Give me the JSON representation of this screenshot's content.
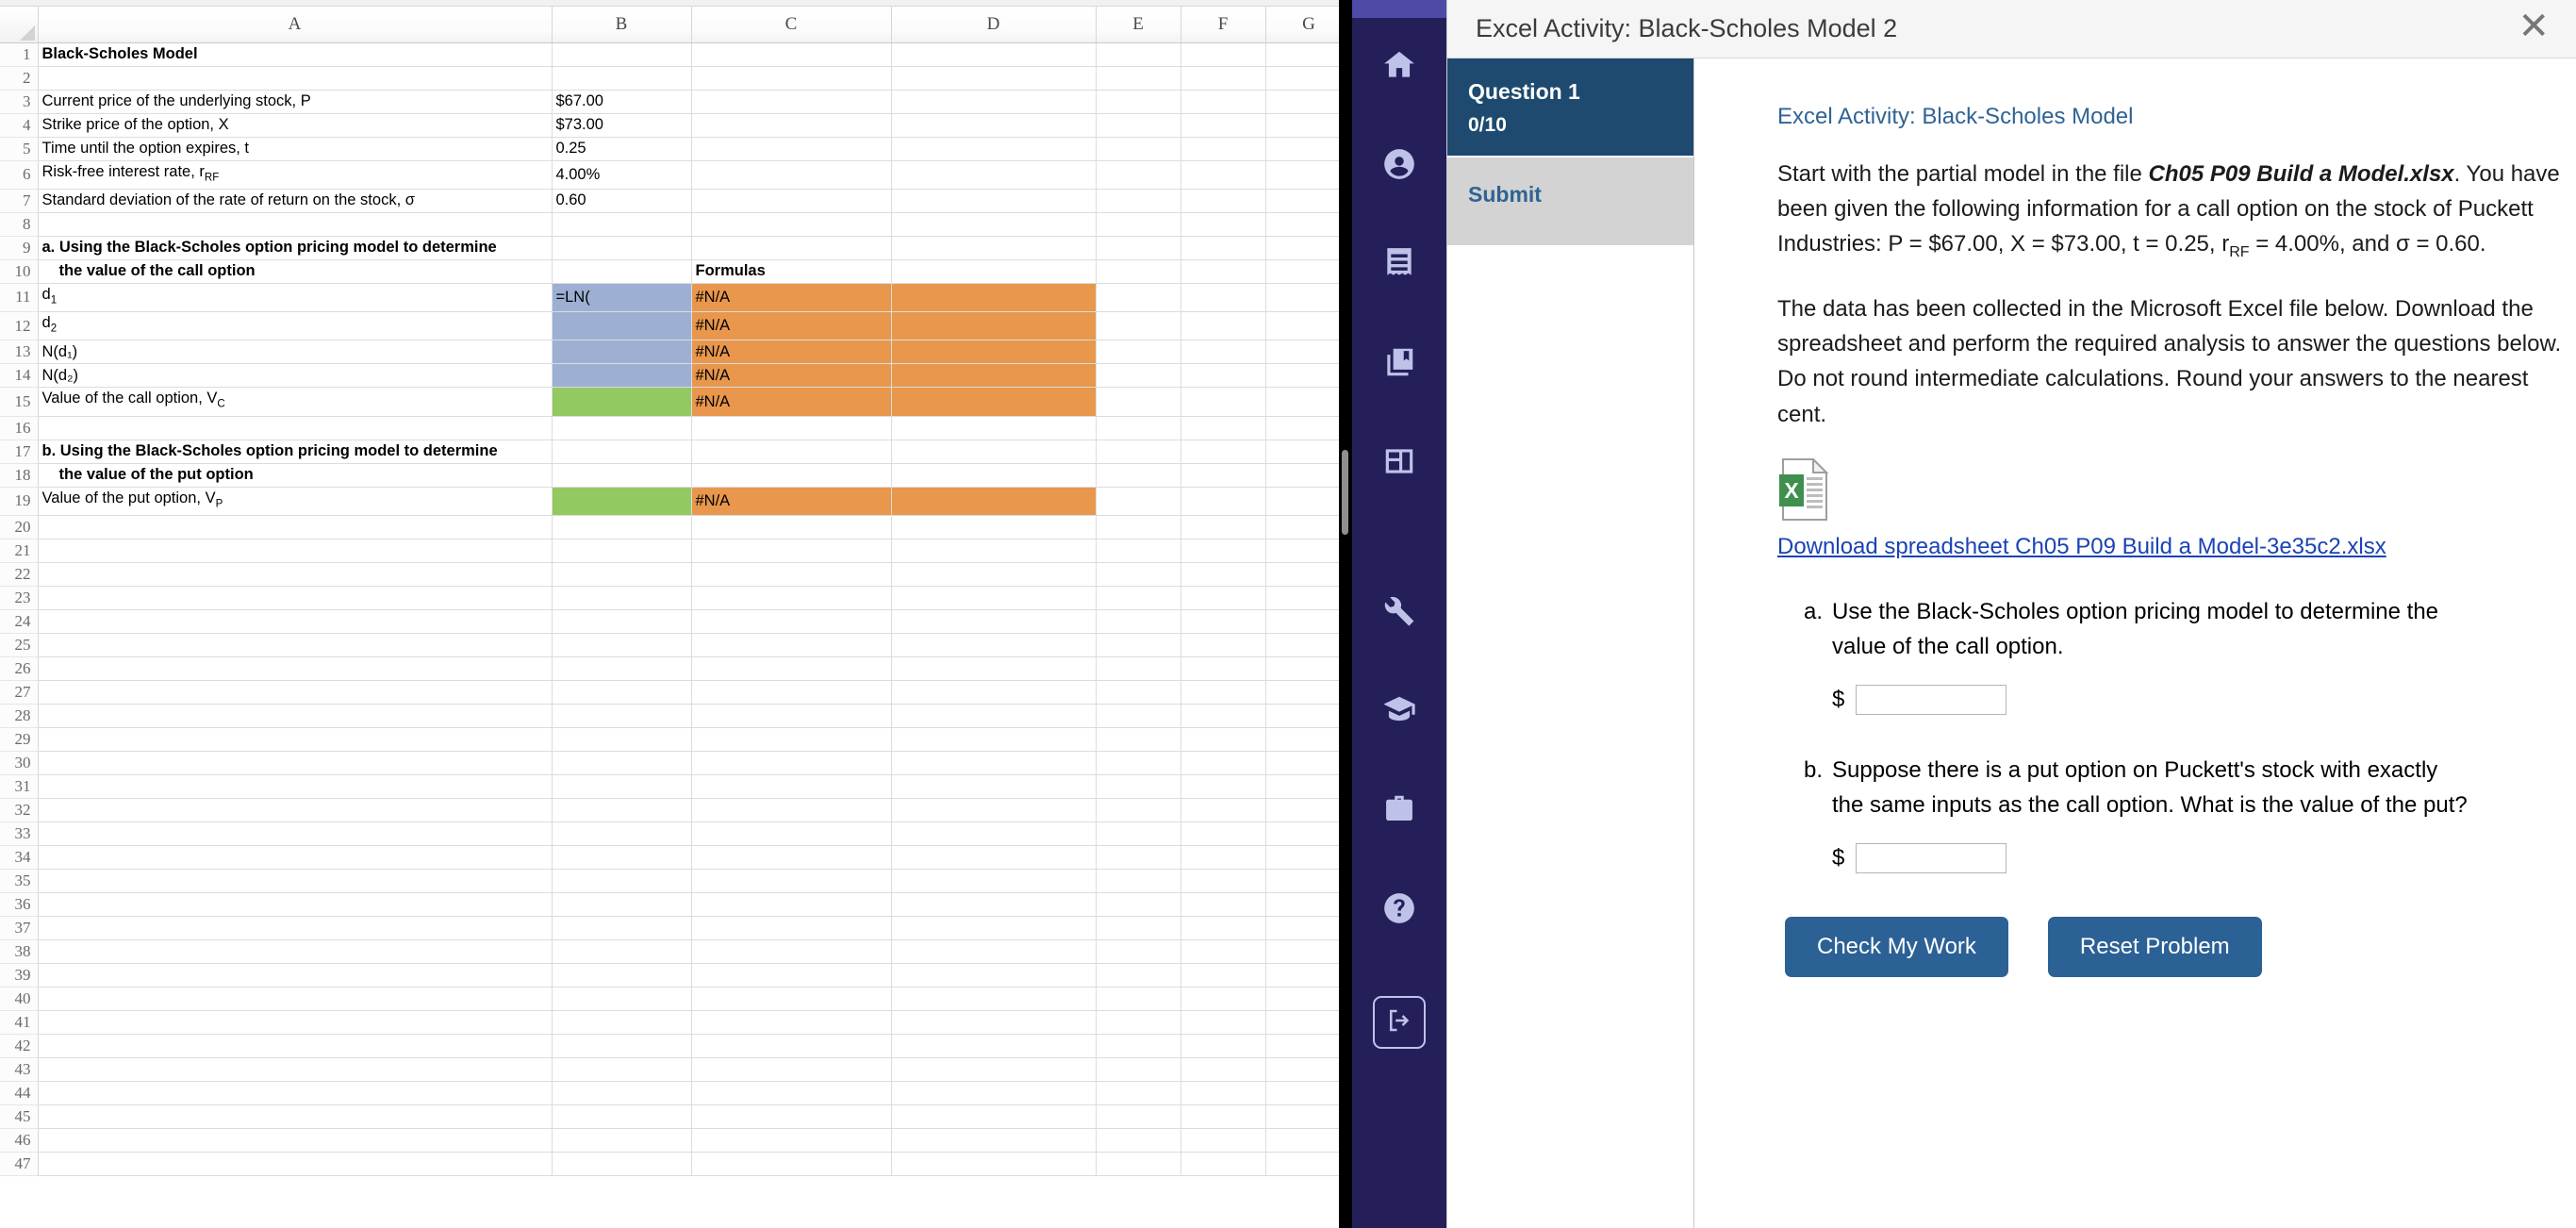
{
  "spreadsheet": {
    "column_headers": [
      "A",
      "B",
      "C",
      "D",
      "E",
      "F",
      "G"
    ],
    "row_count": 47,
    "rows": [
      {
        "n": 1,
        "a": "Black-Scholes Model",
        "a_bold": true,
        "b": "",
        "c": ""
      },
      {
        "n": 2,
        "a": "",
        "b": "",
        "c": ""
      },
      {
        "n": 3,
        "a": "Current price of the underlying stock, P",
        "b": "$67.00",
        "c": ""
      },
      {
        "n": 4,
        "a": "Strike price of the option, X",
        "b": "$73.00",
        "c": ""
      },
      {
        "n": 5,
        "a": "Time until the option expires, t",
        "b": "0.25",
        "c": ""
      },
      {
        "n": 6,
        "a": "Risk-free interest rate, r",
        "a_sub": "RF",
        "b": "4.00%",
        "c": ""
      },
      {
        "n": 7,
        "a": "Standard deviation of the rate of return on the stock, σ",
        "b": "0.60",
        "c": ""
      },
      {
        "n": 8,
        "a": "",
        "b": "",
        "c": ""
      },
      {
        "n": 9,
        "a": "a.  Using the Black-Scholes option pricing model to determine",
        "a_bold": true,
        "b": "",
        "c": ""
      },
      {
        "n": 10,
        "a": "the value of the call option",
        "a_bold": true,
        "a_indent": true,
        "b": "",
        "c": "Formulas",
        "c_bold": true
      },
      {
        "n": 11,
        "a": "d",
        "a_sub": "1",
        "b": "=LN(",
        "b_fill": "blue",
        "c": "#N/A",
        "c_fill": "orange"
      },
      {
        "n": 12,
        "a": "d",
        "a_sub": "2",
        "b": "",
        "b_fill": "blue",
        "c": "#N/A",
        "c_fill": "orange"
      },
      {
        "n": 13,
        "a": "N(d₁)",
        "b": "",
        "b_fill": "blue",
        "c": "#N/A",
        "c_fill": "orange"
      },
      {
        "n": 14,
        "a": "N(d₂)",
        "b": "",
        "b_fill": "blue",
        "c": "#N/A",
        "c_fill": "orange"
      },
      {
        "n": 15,
        "a": "Value of the call option, V",
        "a_sub": "C",
        "b": "",
        "b_fill": "green",
        "c": "#N/A",
        "c_fill": "orange"
      },
      {
        "n": 16,
        "a": "",
        "b": "",
        "c": ""
      },
      {
        "n": 17,
        "a": "b.  Using the Black-Scholes option pricing model to determine",
        "a_bold": true,
        "b": "",
        "c": ""
      },
      {
        "n": 18,
        "a": "the value of the put option",
        "a_bold": true,
        "a_indent": true,
        "b": "",
        "c": ""
      },
      {
        "n": 19,
        "a": "Value of the put option, V",
        "a_sub": "P",
        "b": "",
        "b_fill": "green",
        "c": "#N/A",
        "c_fill": "orange"
      },
      {
        "n": 20,
        "a": "",
        "b": "",
        "c": ""
      },
      {
        "n": 21,
        "a": "",
        "b": "",
        "c": ""
      },
      {
        "n": 22,
        "a": "",
        "b": "",
        "c": ""
      },
      {
        "n": 23,
        "a": "",
        "b": "",
        "c": ""
      },
      {
        "n": 24,
        "a": "",
        "b": "",
        "c": ""
      },
      {
        "n": 25,
        "a": "",
        "b": "",
        "c": ""
      },
      {
        "n": 26,
        "a": "",
        "b": "",
        "c": ""
      },
      {
        "n": 27,
        "a": "",
        "b": "",
        "c": ""
      },
      {
        "n": 28,
        "a": "",
        "b": "",
        "c": ""
      },
      {
        "n": 29,
        "a": "",
        "b": "",
        "c": ""
      },
      {
        "n": 30,
        "a": "",
        "b": "",
        "c": ""
      },
      {
        "n": 31,
        "a": "",
        "b": "",
        "c": ""
      },
      {
        "n": 32,
        "a": "",
        "b": "",
        "c": ""
      },
      {
        "n": 33,
        "a": "",
        "b": "",
        "c": ""
      },
      {
        "n": 34,
        "a": "",
        "b": "",
        "c": ""
      },
      {
        "n": 35,
        "a": "",
        "b": "",
        "c": ""
      },
      {
        "n": 36,
        "a": "",
        "b": "",
        "c": ""
      },
      {
        "n": 37,
        "a": "",
        "b": "",
        "c": ""
      },
      {
        "n": 38,
        "a": "",
        "b": "",
        "c": ""
      },
      {
        "n": 39,
        "a": "",
        "b": "",
        "c": ""
      },
      {
        "n": 40,
        "a": "",
        "b": "",
        "c": ""
      },
      {
        "n": 41,
        "a": "",
        "b": "",
        "c": ""
      },
      {
        "n": 42,
        "a": "",
        "b": "",
        "c": ""
      },
      {
        "n": 43,
        "a": "",
        "b": "",
        "c": ""
      },
      {
        "n": 44,
        "a": "",
        "b": "",
        "c": ""
      },
      {
        "n": 45,
        "a": "",
        "b": "",
        "c": ""
      },
      {
        "n": 46,
        "a": "",
        "b": "",
        "c": ""
      },
      {
        "n": 47,
        "a": "",
        "b": "",
        "c": ""
      }
    ],
    "fill_colors": {
      "blue": "#9db0d4",
      "green": "#93c961",
      "orange": "#e8974c"
    },
    "active_cell_formula": "=LN("
  },
  "nav_rail": {
    "background": "#241f59",
    "accent": "#4e4aa8",
    "icon_color": "#bfc2e8",
    "items": [
      {
        "icon": "home-icon",
        "label": "Home"
      },
      {
        "icon": "account-icon",
        "label": "Account"
      },
      {
        "icon": "receipt-icon",
        "label": "Assignments"
      },
      {
        "icon": "book-icon",
        "label": "Library"
      },
      {
        "icon": "dashboard-icon",
        "label": "Dashboard"
      },
      {
        "icon": "wrench-icon",
        "label": "Tools"
      },
      {
        "icon": "graduation-cap-icon",
        "label": "Courses"
      },
      {
        "icon": "briefcase-icon",
        "label": "Career"
      },
      {
        "icon": "question-mark-icon",
        "label": "Help"
      },
      {
        "icon": "logout-icon",
        "label": "Sign out"
      }
    ]
  },
  "activity": {
    "title": "Excel Activity: Black-Scholes Model 2",
    "close_label": "✕",
    "question_tile": {
      "name": "Question 1",
      "score": "0/10"
    },
    "submit_label": "Submit",
    "heading": "Excel Activity: Black-Scholes Model",
    "paragraph1_prefix": "Start with the partial model in the file ",
    "paragraph1_file": "Ch05 P09 Build a Model.xlsx",
    "paragraph1_mid": ". You have been given the following information for a call option on the stock of Puckett Industries: P = $67.00, X = $73.00, t = 0.25, r",
    "paragraph1_sub": "RF",
    "paragraph1_suffix": " = 4.00%, and σ = 0.60.",
    "paragraph2": "The data has been collected in the Microsoft Excel file below. Download the spreadsheet and perform the required analysis to answer the questions below. Do not round intermediate calculations. Round your answers to the nearest cent.",
    "download_link": "Download spreadsheet Ch05 P09 Build a Model-3e35c2.xlsx",
    "sub_questions": [
      {
        "label": "a.",
        "text": "Use the Black-Scholes option pricing model to determine the value of the call option.",
        "answer_prefix": "$",
        "answer_value": ""
      },
      {
        "label": "b.",
        "text": "Suppose there is a put option on Puckett's stock with exactly the same inputs as the call option. What is the value of the put?",
        "answer_prefix": "$",
        "answer_value": ""
      }
    ],
    "buttons": {
      "check": "Check My Work",
      "reset": "Reset Problem"
    },
    "accent_color": "#2b6195",
    "link_color": "#1a43b4",
    "heading_color": "#2f6394"
  }
}
